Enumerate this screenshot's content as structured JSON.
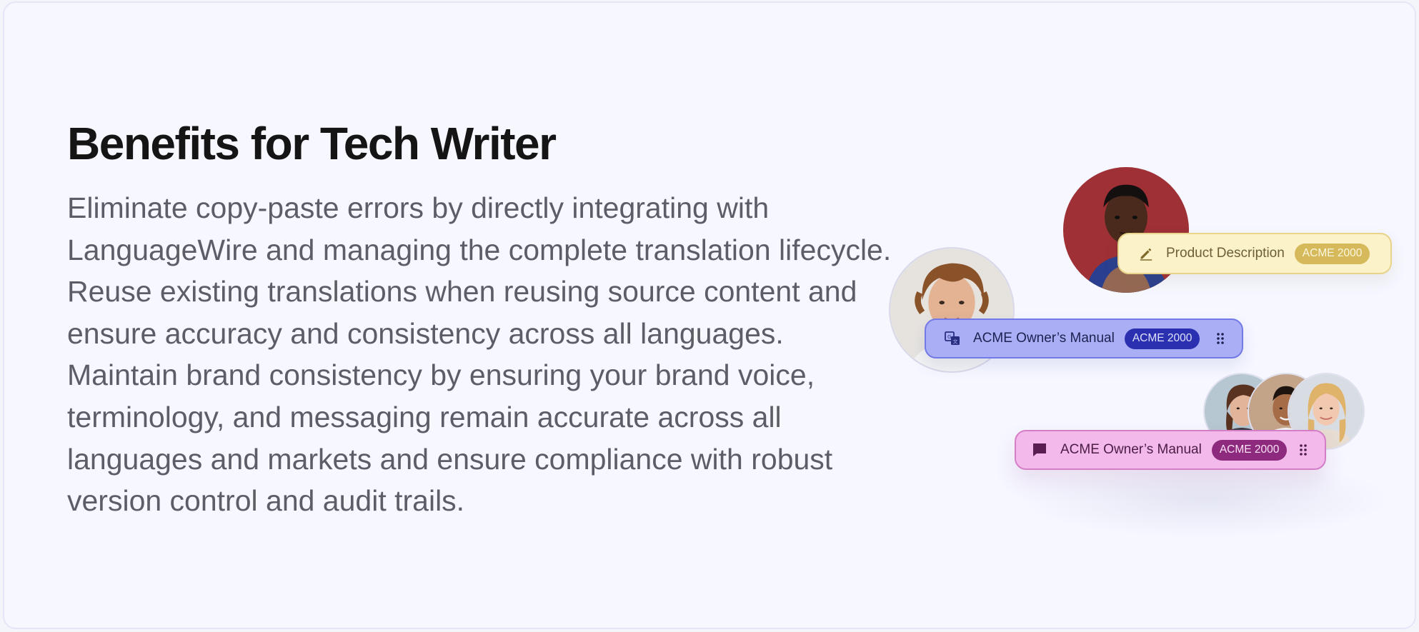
{
  "section": {
    "title": "Benefits for Tech Writer",
    "description": "Eliminate copy-paste errors by directly integrating with LanguageWire and managing the complete translation lifecycle. Reuse existing translations when reusing source content and ensure accuracy and consistency across all languages. Maintain brand consistency by ensuring your brand voice, terminology, and messaging remain accurate across all languages and markets and ensure compliance with robust version control and audit trails."
  },
  "cards": [
    {
      "label": "Product Description",
      "tag": "ACME 2000",
      "icon": "pencil-icon",
      "color": "#fbf2c9"
    },
    {
      "label": "ACME Owner’s Manual",
      "tag": "ACME 2000",
      "icon": "translate-icon",
      "color": "#a9aef5"
    },
    {
      "label": "ACME Owner’s Manual",
      "tag": "ACME 2000",
      "icon": "comment-icon",
      "color": "#f3b9ea"
    }
  ],
  "colors": {
    "title": "#151515",
    "body_text": "#5d5d65",
    "card_background": "#f6f7ff",
    "yellow_tag": "#d6b95a",
    "blue_tag": "#2b30b0",
    "pink_tag": "#8d2a7d"
  }
}
